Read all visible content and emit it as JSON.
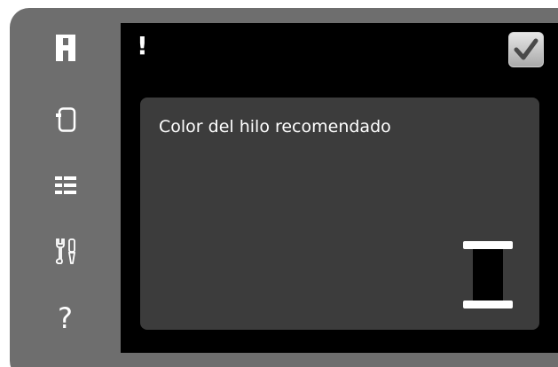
{
  "sidebar": {
    "items": [
      {
        "icon": "home-icon"
      },
      {
        "icon": "sewing-mode-icon"
      },
      {
        "icon": "menu-list-icon"
      },
      {
        "icon": "settings-tools-icon"
      },
      {
        "icon": "help-icon",
        "label": "?"
      }
    ]
  },
  "screen": {
    "alert_symbol": "!",
    "confirm_icon": "checkmark-icon"
  },
  "dialog": {
    "title": "Color del hilo recomendado",
    "icon": "thread-spool-icon"
  },
  "colors": {
    "frame": "#6e6e6e",
    "screen_bg": "#000000",
    "panel_bg": "#3c3c3c",
    "text": "#ffffff"
  }
}
